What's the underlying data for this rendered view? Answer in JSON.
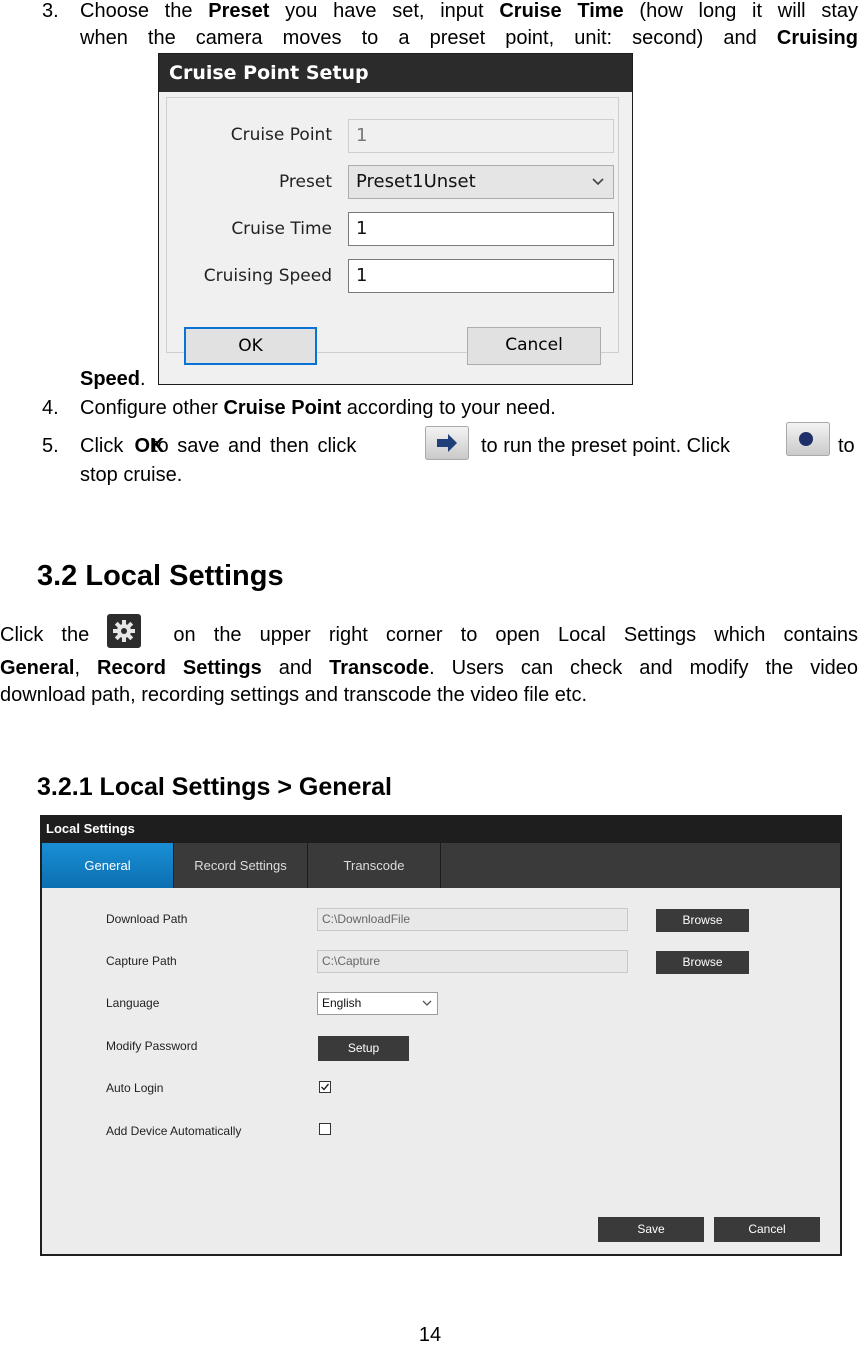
{
  "steps": {
    "s3": {
      "num": "3.",
      "t1": "Choose the",
      "b1": "Preset",
      "t2": "you have set, input",
      "b2": "Cruise Time",
      "t3": "(how long it will stay",
      "line2_t": "when the camera moves to a preset point, unit: second) and",
      "line2_b": "Cruising",
      "b3": "Speed",
      "t4": "."
    },
    "s4": {
      "num": "4.",
      "t1": "Configure other",
      "b1": "Cruise Point",
      "t2": "according to your need."
    },
    "s5": {
      "num": "5.",
      "t1": "Click",
      "b1": "OK",
      "t2": "to save and then click",
      "t3": "to run the preset point. Click",
      "t4": "to",
      "line2": "stop cruise."
    }
  },
  "cruise_dialog": {
    "title": "Cruise Point Setup",
    "fields": [
      {
        "label": "Cruise Point",
        "value": "1"
      },
      {
        "label": "Preset",
        "value": "Preset1Unset"
      },
      {
        "label": "Cruise Time",
        "value": "1"
      },
      {
        "label": "Cruising Speed",
        "value": "1"
      }
    ],
    "ok": "OK",
    "cancel": "Cancel"
  },
  "section_32": {
    "heading": "3.2 Local Settings",
    "p_t1": "Click the",
    "p_t2": "on the upper right corner to open Local Settings which contains",
    "p_b1": "General",
    "p_sep": ",",
    "p_b2": "Record Settings",
    "p_and": "and",
    "p_b3": "Transcode",
    "p_t3": ". Users can check and modify the video",
    "p_line3": "download path, recording settings and transcode the video file etc."
  },
  "section_321": {
    "heading": "3.2.1 Local Settings > General"
  },
  "local_settings": {
    "title": "Local Settings",
    "tabs": [
      "General",
      "Record Settings",
      "Transcode"
    ],
    "rows": {
      "download_path": {
        "label": "Download Path",
        "value": "C:\\DownloadFile",
        "button": "Browse"
      },
      "capture_path": {
        "label": "Capture Path",
        "value": "C:\\Capture",
        "button": "Browse"
      },
      "language": {
        "label": "Language",
        "value": "English"
      },
      "modify_password": {
        "label": "Modify Password",
        "button": "Setup"
      },
      "auto_login": {
        "label": "Auto Login",
        "checked": true
      },
      "add_device": {
        "label": "Add Device Automatically",
        "checked": false
      }
    },
    "save": "Save",
    "cancel": "Cancel"
  },
  "page_number": "14",
  "icons": [
    "right-arrow-icon",
    "record-dot-icon",
    "gear-icon",
    "chevron-down-icon",
    "checkmark-icon"
  ]
}
